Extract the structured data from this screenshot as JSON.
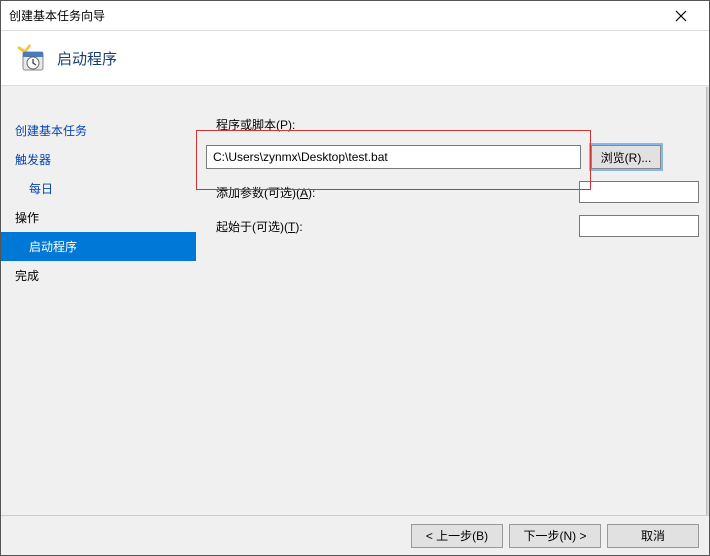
{
  "window": {
    "title": "创建基本任务向导"
  },
  "header": {
    "title": "启动程序"
  },
  "sidebar": {
    "items": [
      {
        "label": "创建基本任务",
        "link": true,
        "sub": false
      },
      {
        "label": "触发器",
        "link": true,
        "sub": false
      },
      {
        "label": "每日",
        "link": true,
        "sub": true
      },
      {
        "label": "操作",
        "link": false,
        "sub": false
      },
      {
        "label": "启动程序",
        "active": true,
        "sub": true
      },
      {
        "label": "完成",
        "link": false,
        "sub": false
      }
    ]
  },
  "form": {
    "program_label": "程序或脚本(P):",
    "program_hotkey": "P",
    "program_value": "C:\\Users\\zynmx\\Desktop\\test.bat",
    "browse_label": "浏览(R)...",
    "args_label": "添加参数(可选)(A):",
    "args_value": "",
    "startin_label": "起始于(可选)(T):",
    "startin_value": ""
  },
  "footer": {
    "back": "< 上一步(B)",
    "next": "下一步(N) >",
    "cancel": "取消"
  }
}
